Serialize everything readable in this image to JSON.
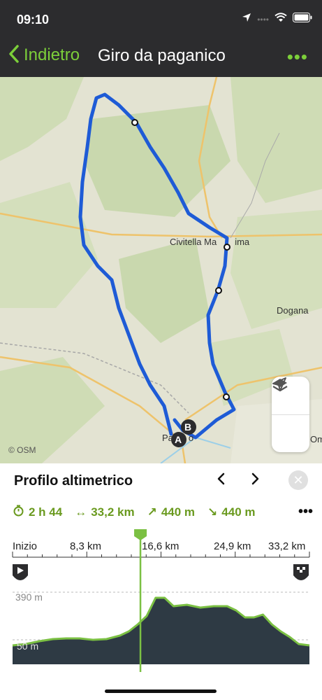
{
  "status": {
    "time": "09:10"
  },
  "nav": {
    "back_label": "Indietro",
    "title": "Giro da paganico",
    "more": "•••"
  },
  "map": {
    "labels": {
      "civitella": "Civitella Ma",
      "civitella_rest": "ima",
      "dogana": "Dogana",
      "paganico": "Pa",
      "paganico_rest": "o",
      "om": "Om"
    },
    "attribution": "© OSM",
    "markers": {
      "start": "A",
      "end": "B"
    }
  },
  "panel": {
    "title": "Profilo altimetrico",
    "prev": "‹",
    "next": "›",
    "close": "✕",
    "stats": {
      "duration": "2 h 44",
      "distance": "33,2 km",
      "ascent": "440 m",
      "descent": "440 m"
    },
    "more": "•••"
  },
  "chart_data": {
    "type": "area",
    "title": "Profilo altimetrico",
    "x_tick_labels": [
      "Inizio",
      "8,3 km",
      "16,6 km",
      "24,9 km",
      "33,2 km"
    ],
    "y_tick_labels": [
      "390 m",
      "50 m"
    ],
    "x_unit": "km",
    "y_unit": "m",
    "xlim": [
      0,
      33.2
    ],
    "ylim": [
      50,
      390
    ],
    "cursor_km": 14.3,
    "series": [
      {
        "x": [
          0,
          1.5,
          3,
          4.5,
          6,
          7.5,
          9,
          10.5,
          12,
          13,
          14,
          15,
          16,
          17,
          18,
          19.5,
          21,
          22.5,
          24,
          25,
          26,
          27,
          28,
          29,
          30,
          31,
          32,
          33.2
        ],
        "y": [
          50,
          60,
          80,
          95,
          100,
          100,
          90,
          95,
          120,
          150,
          200,
          260,
          390,
          390,
          330,
          340,
          320,
          330,
          330,
          300,
          250,
          250,
          270,
          200,
          150,
          110,
          60,
          50
        ]
      }
    ],
    "colors": {
      "fill": "#2e3a44",
      "line": "#7bc043",
      "cursor": "#7bc043"
    }
  },
  "colors": {
    "accent": "#7ccf3a",
    "route": "#1e5bd6"
  }
}
